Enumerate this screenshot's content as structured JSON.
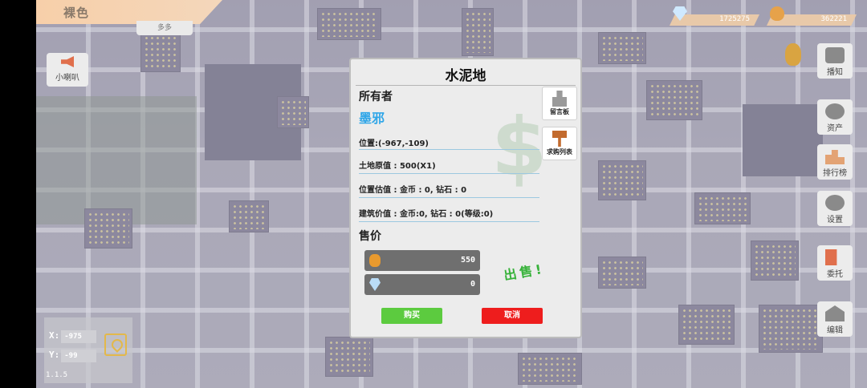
{
  "top": {
    "title": "裸色",
    "tab": "多多",
    "horn_label": "小喇叭"
  },
  "currency": {
    "diamonds": "1725275",
    "gold": "362221"
  },
  "right_menu": [
    {
      "label": "播知",
      "icon": "chat-icon"
    },
    {
      "label": "资产",
      "icon": "gear-icon"
    },
    {
      "label": "排行榜",
      "icon": "rank-icon"
    },
    {
      "label": "设置",
      "icon": "settings-icon"
    },
    {
      "label": "委托",
      "icon": "trade-icon"
    },
    {
      "label": "编辑",
      "icon": "edit-icon"
    }
  ],
  "coords": {
    "x_label": "X:",
    "x": "-975",
    "y_label": "Y:",
    "y": "-99",
    "version": "1.1.5"
  },
  "dialog": {
    "title": "水泥地",
    "owner_label": "所有者",
    "owner_name": "墨邪",
    "position": "位置:(-967,-109)",
    "land_value": "土地原值 : 500(X1)",
    "position_value": "位置估值 : 金币 : 0, 钻石 : 0",
    "building_value": "建筑价值 : 金币:0, 钻石 : 0(等级:0)",
    "price_label": "售价",
    "gold_price": "550",
    "diamond_price": "0",
    "sell_text": "出售!",
    "message_board": "留言板",
    "purchase_list": "求购列表",
    "buy": "购买",
    "cancel": "取消"
  },
  "colors": {
    "owner": "#2fa6e8",
    "buy": "#5ccb3f",
    "cancel": "#ee1d1d",
    "sell": "#37b23a",
    "banner": "#f7cfa9"
  }
}
